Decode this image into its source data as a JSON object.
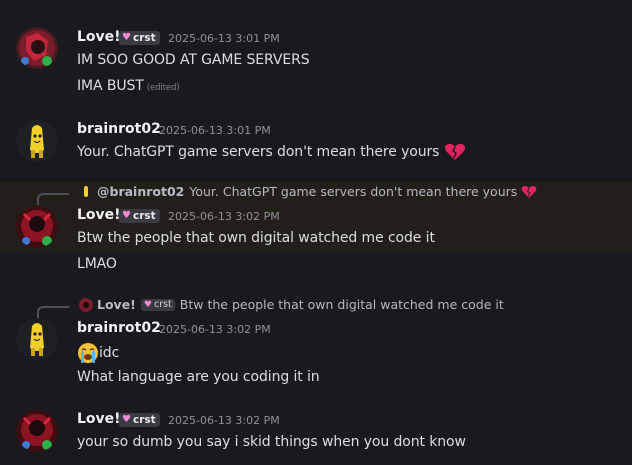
{
  "users": {
    "love": {
      "name": "Love!",
      "tag": "crst"
    },
    "brainrot": {
      "name": "brainrot02"
    }
  },
  "messages": [
    {
      "author": "Love!",
      "tag": "crst",
      "timestamp": "2025-06-13 3:01 PM",
      "lines": [
        "IM SOO GOOD AT GAME SERVERS",
        "IMA BUST"
      ],
      "edited_label": "(edited)"
    },
    {
      "author": "brainrot02",
      "timestamp": "2025-06-13 3:01 PM",
      "lines": [
        "Your. ChatGPT game servers don't mean there yours"
      ]
    },
    {
      "author": "Love!",
      "tag": "crst",
      "timestamp": "2025-06-13 3:02 PM",
      "reply": {
        "author": "@brainrot02",
        "text": "Your. ChatGPT game servers don't mean there yours"
      },
      "lines": [
        "Btw the people that own digital watched me code it",
        "LMAO"
      ]
    },
    {
      "author": "brainrot02",
      "timestamp": "2025-06-13 3:02 PM",
      "reply": {
        "author": "Love!",
        "tag": "crst",
        "text": "Btw the people that own digital watched me code it"
      },
      "lines": [
        "idc",
        "What language are you coding it in"
      ]
    },
    {
      "author": "Love!",
      "tag": "crst",
      "timestamp": "2025-06-13 3:02 PM",
      "lines": [
        "your so dumb you say i skid things when you dont know"
      ]
    }
  ],
  "icons": {
    "broken_heart": "broken-heart-emoji",
    "crying": "loudly-crying-emoji",
    "tag_heart": "pink-heart-icon"
  },
  "colors": {
    "background": "#1a1a1e",
    "highlight": "#221f1b",
    "tag_heart": "#f58bd4",
    "broken_heart": "#e0245e"
  }
}
